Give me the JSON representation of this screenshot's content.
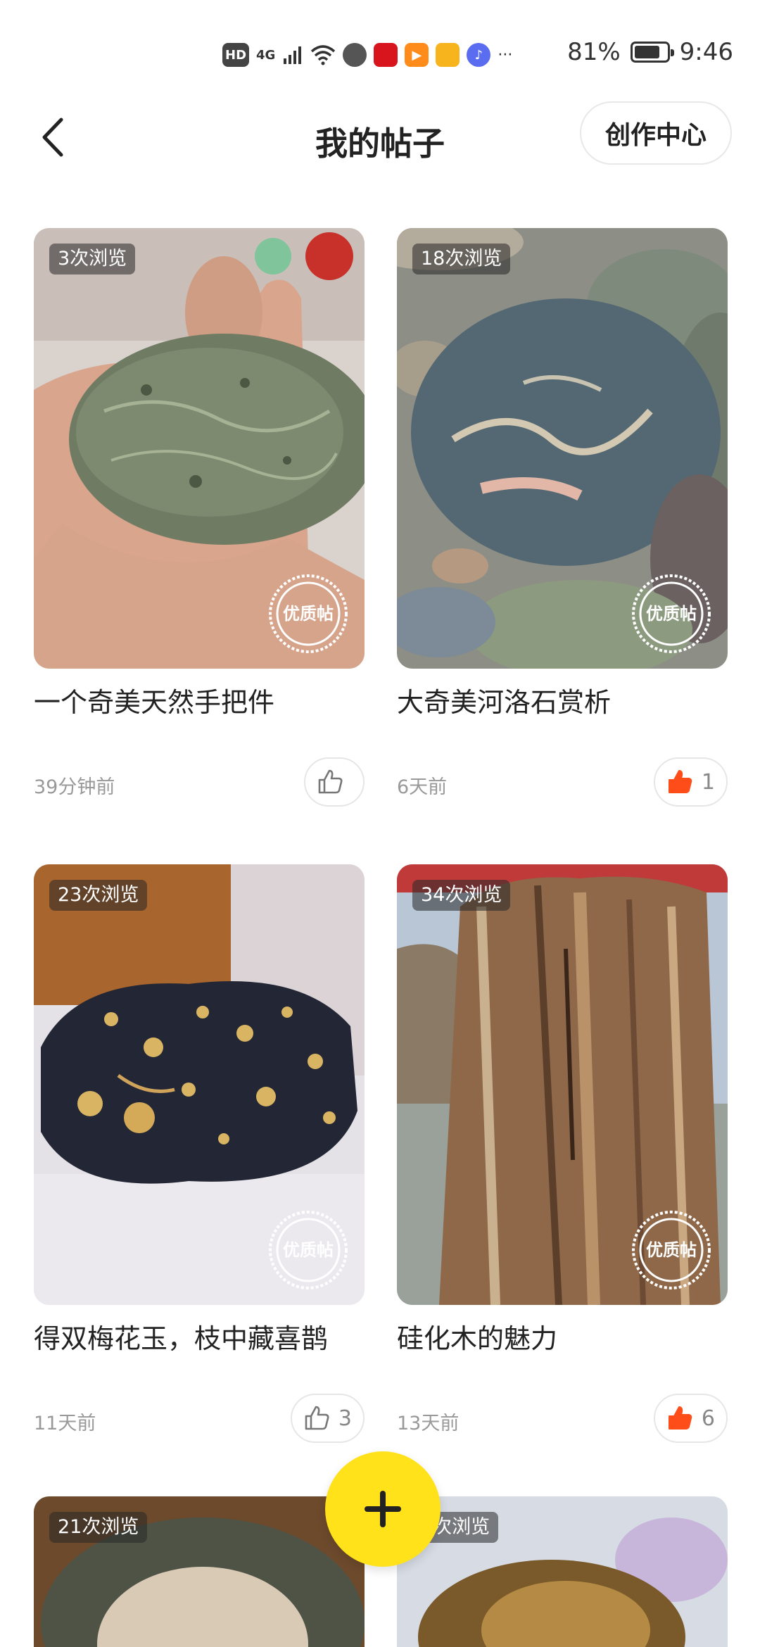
{
  "status_bar": {
    "battery": "81%",
    "battery_level": 0.81,
    "time": "9:46",
    "network": "4G",
    "hd": "HD",
    "more": "···"
  },
  "header": {
    "title": "我的帖子",
    "creator_center": "创作中心"
  },
  "posts": [
    {
      "views": "3次浏览",
      "title": "一个奇美天然手把件",
      "time": "39分钟前",
      "likes": "",
      "liked": false,
      "quality_badge": "优质帖"
    },
    {
      "views": "18次浏览",
      "title": "大奇美河洛石赏析",
      "time": "6天前",
      "likes": "1",
      "liked": true,
      "quality_badge": "优质帖"
    },
    {
      "views": "23次浏览",
      "title": "得双梅花玉，枝中藏喜鹊",
      "time": "11天前",
      "likes": "3",
      "liked": false,
      "quality_badge": "优质帖"
    },
    {
      "views": "34次浏览",
      "title": "硅化木的魅力",
      "time": "13天前",
      "likes": "6",
      "liked": true,
      "quality_badge": "优质帖"
    },
    {
      "views": "21次浏览"
    },
    {
      "views": "2次浏览"
    }
  ],
  "fab": {
    "icon": "plus-icon"
  },
  "colors": {
    "accent": "#ffe21a",
    "liked": "#ff4d1a"
  }
}
